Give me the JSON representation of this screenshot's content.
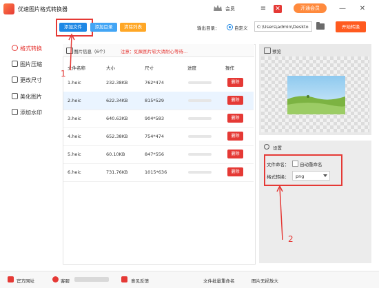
{
  "app": {
    "title": "优速图片格式转换器",
    "member_label": "会员",
    "vip_button": "开通会员"
  },
  "window_controls": {
    "menu": "≡",
    "minimize": "—",
    "close": "✕"
  },
  "toolbar": {
    "add_file": "添加文件",
    "add_dir": "添加目录",
    "clear_list": "清除列表",
    "output_dir_label": "输出目录：",
    "custom_label": "自定义",
    "output_path": "C:\\Users\\admin\\Deskto",
    "start_button": "开始转换"
  },
  "sidebar": {
    "items": [
      {
        "label": "格式转换",
        "icon": "format-convert-icon",
        "active": true
      },
      {
        "label": "图片压缩",
        "icon": "image-compress-icon",
        "active": false
      },
      {
        "label": "更改尺寸",
        "icon": "resize-icon",
        "active": false
      },
      {
        "label": "美化图片",
        "icon": "beautify-icon",
        "active": false
      },
      {
        "label": "添加水印",
        "icon": "watermark-icon",
        "active": false
      }
    ]
  },
  "file_panel": {
    "title": "图片信息（6个）",
    "note": "注意：如果图片较大请耐心等待...",
    "columns": [
      "文件名称",
      "大小",
      "尺寸",
      "进度",
      "操作"
    ],
    "delete_label": "删除",
    "rows": [
      {
        "name": "1.heic",
        "size": "232.38KB",
        "dims": "762*474",
        "progress": 0
      },
      {
        "name": "2.heic",
        "size": "622.34KB",
        "dims": "815*529",
        "progress": 0
      },
      {
        "name": "3.heic",
        "size": "640.63KB",
        "dims": "904*583",
        "progress": 0
      },
      {
        "name": "4.heic",
        "size": "652.38KB",
        "dims": "754*474",
        "progress": 0
      },
      {
        "name": "5.heic",
        "size": "60.10KB",
        "dims": "847*556",
        "progress": 0
      },
      {
        "name": "6.heic",
        "size": "731.76KB",
        "dims": "1015*636",
        "progress": 0
      }
    ]
  },
  "preview": {
    "title": "预览"
  },
  "settings": {
    "title": "设置",
    "file_naming_label": "文件命名：",
    "auto_rename_label": "自动重命名",
    "format_label": "格式转换：",
    "format_value": "png"
  },
  "annotations": {
    "one": "1",
    "two": "2"
  },
  "footer": {
    "website": "官方网址",
    "support": "客服",
    "feedback": "意见反馈",
    "batch_rename": "文件批量重命名",
    "lossless_enlarge": "图片无损放大"
  },
  "colors": {
    "accent": "#e53935",
    "start": "#ff5a1f",
    "vip": "#ff8a3d",
    "add_file": "#1e88e5",
    "add_dir": "#42a5f5",
    "clear": "#ffa726"
  }
}
